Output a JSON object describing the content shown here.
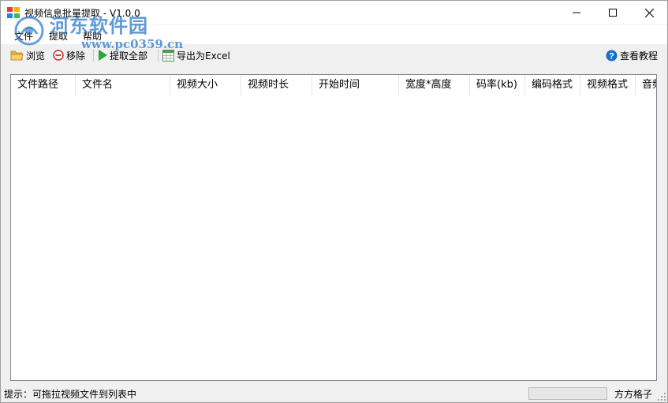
{
  "window": {
    "title": "视频信息批量提取 - V1.0.0",
    "controls": {
      "minimize": "—",
      "maximize": "☐",
      "close": "✕"
    }
  },
  "watermark": {
    "name": "河东软件园",
    "url": "www.pc0359.cn"
  },
  "menu": {
    "items": [
      {
        "label": "文件"
      },
      {
        "label": "提取"
      },
      {
        "label": "帮助"
      }
    ]
  },
  "toolbar": {
    "browse_label": "浏览",
    "remove_label": "移除",
    "extract_all_label": "提取全部",
    "export_label": "导出为Excel",
    "help_label": "查看教程"
  },
  "list": {
    "columns": [
      "文件路径",
      "文件名",
      "视频大小",
      "视频时长",
      "开始时间",
      "宽度*高度",
      "码率(kb)",
      "编码格式",
      "视频格式",
      "音频"
    ],
    "rows": []
  },
  "status": {
    "tip": "提示：可拖拉视频文件到列表中",
    "progress": 0,
    "author": "方方格子"
  },
  "colors": {
    "accent": "#1a6fc9",
    "progress": "#06b025",
    "extract_icon": "#1faa3a",
    "remove_icon": "#d42a2a",
    "folder_icon": "#e8b530"
  }
}
